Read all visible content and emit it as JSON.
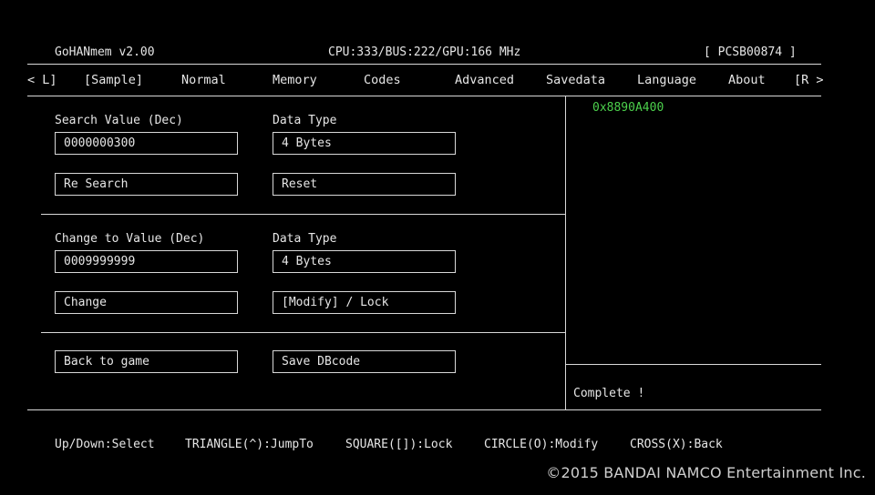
{
  "header": {
    "app_title": "GoHANmem v2.00",
    "cpu_info": "CPU:333/BUS:222/GPU:166 MHz",
    "game_id": "[ PCSB00874 ]"
  },
  "tabs": {
    "prev": "< L]",
    "items": [
      "[Sample]",
      "Normal",
      "Memory",
      "Codes",
      "Advanced",
      "Savedata",
      "Language",
      "About"
    ],
    "next": "[R >"
  },
  "search": {
    "value_label": "Search Value (Dec)",
    "value": "0000000300",
    "type_label": "Data Type",
    "type_value": "4 Bytes",
    "research_button": "Re Search",
    "reset_button": "Reset"
  },
  "change": {
    "value_label": "Change to Value (Dec)",
    "value": "0009999999",
    "type_label": "Data Type",
    "type_value": "4 Bytes",
    "change_button": "Change",
    "mode_button": "[Modify] / Lock"
  },
  "footer_buttons": {
    "back_button": "Back to game",
    "save_button": "Save DBcode"
  },
  "results": {
    "addresses": [
      "0x8890A400"
    ],
    "status": "Complete !"
  },
  "hints": [
    "Up/Down:Select",
    "TRIANGLE(^):JumpTo",
    "SQUARE([]):Lock",
    "CIRCLE(O):Modify",
    "CROSS(X):Back"
  ],
  "copyright": "©2015 BANDAI NAMCO Entertainment Inc.",
  "colors": {
    "background": "#000000",
    "text": "#e6e6e6",
    "address": "#4cd04c",
    "lines": "#d8d8d8"
  }
}
